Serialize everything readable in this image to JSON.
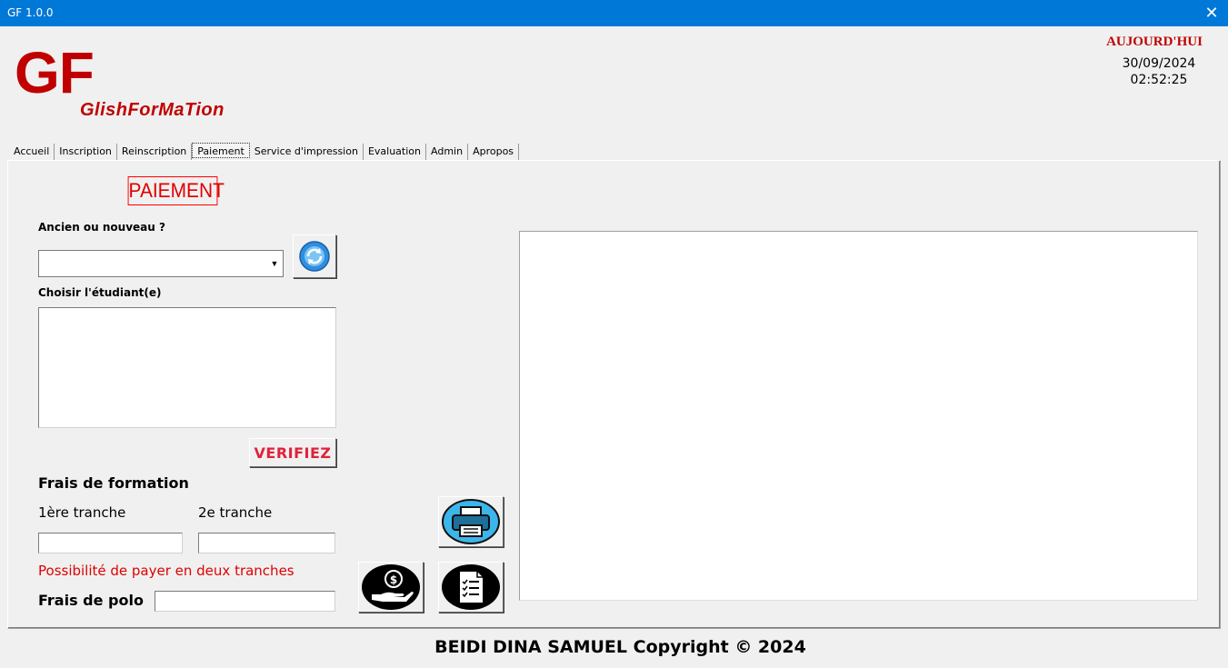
{
  "window": {
    "title": "GF 1.0.0",
    "close_glyph": "✕"
  },
  "brand": {
    "logo": "GF",
    "name": "GlishForMaTion",
    "color": "#c00000"
  },
  "clock": {
    "label": "AUJOURD'HUI",
    "date": "30/09/2024",
    "time": "02:52:25"
  },
  "tabs": [
    {
      "label": "Accueil"
    },
    {
      "label": "Inscription"
    },
    {
      "label": "Reinscription"
    },
    {
      "label": "Paiement",
      "active": true
    },
    {
      "label": "Service d'impression"
    },
    {
      "label": "Evaluation"
    },
    {
      "label": "Admin"
    },
    {
      "label": "Apropos"
    }
  ],
  "payment": {
    "title": "PAIEMENT",
    "old_or_new_label": "Ancien ou nouveau ?",
    "old_or_new_value": "",
    "choose_student_label": "Choisir l'étudiant(e)",
    "verify_button": "VERIFIEZ",
    "training_fees_label": "Frais de formation",
    "first_installment_label": "1ère tranche",
    "second_installment_label": "2e tranche",
    "first_installment_value": "",
    "second_installment_value": "",
    "installment_note": "Possibilité de payer en deux tranches",
    "polo_fees_label": "Frais de polo",
    "polo_fees_value": ""
  },
  "icons": {
    "refresh": "refresh-icon",
    "print": "printer-icon",
    "pay": "money-hand-icon",
    "receipt": "checklist-document-icon"
  },
  "footer": {
    "text": "BEIDI DINA SAMUEL Copyright © 2024"
  },
  "colors": {
    "titlebar": "#0078d7",
    "accent_red": "#e00000",
    "icon_blue": "#3aa0e0"
  }
}
